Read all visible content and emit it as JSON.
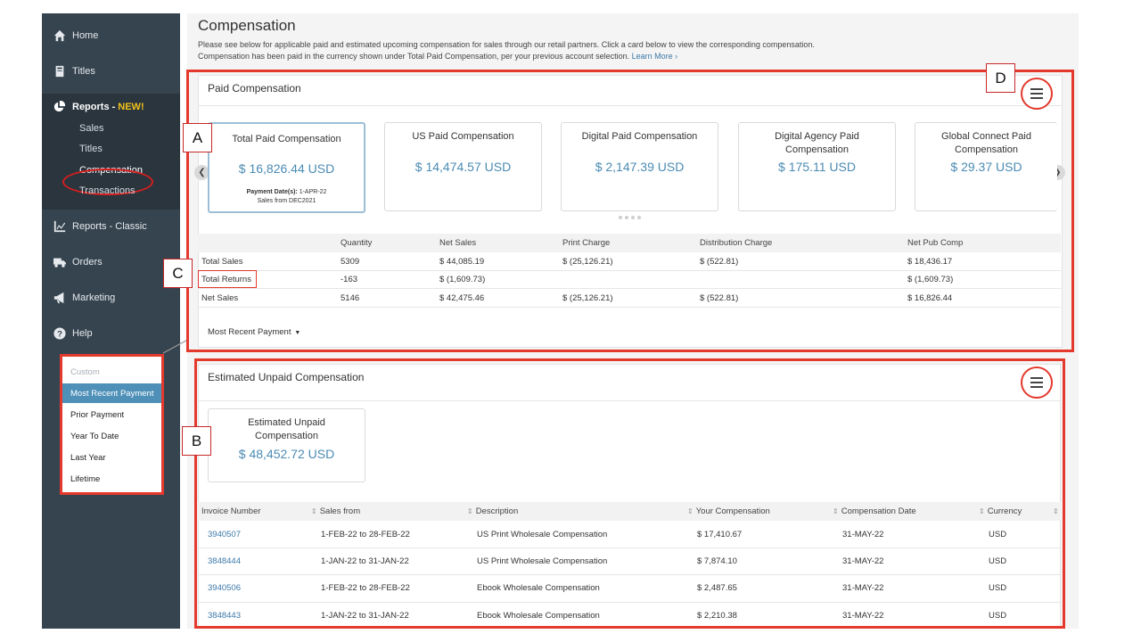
{
  "sidebar": {
    "home": "Home",
    "titles": "Titles",
    "reports": "Reports -",
    "reports_badge": "NEW!",
    "reports_sub": [
      "Sales",
      "Titles",
      "Compensation",
      "Transactions"
    ],
    "reports_classic": "Reports - Classic",
    "orders": "Orders",
    "marketing": "Marketing",
    "help": "Help"
  },
  "dropdown": {
    "options": [
      "Custom",
      "Most Recent Payment",
      "Prior Payment",
      "Year To Date",
      "Last Year",
      "Lifetime"
    ],
    "selected": "Most Recent Payment"
  },
  "header": {
    "title": "Compensation",
    "intro_line1": "Please see below for applicable paid and estimated upcoming compensation for sales through our  retail partners. Click a card below to view the corresponding compensation.",
    "intro_line2": "Compensation has been paid in the currency shown under Total Paid Compensation, per your previous account selection.",
    "learn_more": "Learn More ›"
  },
  "paid": {
    "title": "Paid Compensation",
    "cards": [
      {
        "title": "Total Paid Compensation",
        "amount": "$ 16,826.44 USD",
        "note1_label": "Payment Date(s):",
        "note1_value": "1-APR-22",
        "note2": "Sales from DEC2021"
      },
      {
        "title": "US Paid Compensation",
        "amount": "$ 14,474.57 USD"
      },
      {
        "title": "Digital Paid Compensation",
        "amount": "$ 2,147.39 USD"
      },
      {
        "title": "Digital Agency Paid Compensation",
        "amount": "$ 175.11 USD"
      },
      {
        "title": "Global Connect Paid Compensation",
        "amount": "$ 29.37 USD"
      }
    ],
    "columns": [
      "Quantity",
      "Net Sales",
      "Print Charge",
      "Distribution Charge",
      "Net Pub Comp"
    ],
    "rows": [
      {
        "label": "Total Sales",
        "quantity": "5309",
        "net_sales": "$ 44,085.19",
        "print_charge": "$ (25,126.21)",
        "distribution": "$ (522.81)",
        "net_pub": "$ 18,436.17"
      },
      {
        "label": "Total Returns",
        "quantity": "-163",
        "net_sales": "$ (1,609.73)",
        "print_charge": "",
        "distribution": "",
        "net_pub": "$ (1,609.73)"
      },
      {
        "label": "Net Sales",
        "quantity": "5146",
        "net_sales": "$ 42,475.46",
        "print_charge": "$ (25,126.21)",
        "distribution": "$ (522.81)",
        "net_pub": "$ 16,826.44"
      }
    ],
    "period_button": "Most Recent Payment"
  },
  "unpaid": {
    "title": "Estimated Unpaid Compensation",
    "card": {
      "title": "Estimated Unpaid Compensation",
      "amount": "$ 48,452.72 USD"
    },
    "columns": [
      "Invoice Number",
      "Sales from",
      "Description",
      "Your Compensation",
      "Compensation Date",
      "Currency"
    ],
    "rows": [
      {
        "invoice": "3940507",
        "sales_from": "1-FEB-22 to 28-FEB-22",
        "description": "US Print Wholesale Compensation",
        "comp": "$ 17,410.67",
        "date": "31-MAY-22",
        "currency": "USD"
      },
      {
        "invoice": "3848444",
        "sales_from": "1-JAN-22 to 31-JAN-22",
        "description": "US Print Wholesale Compensation",
        "comp": "$ 7,874.10",
        "date": "31-MAY-22",
        "currency": "USD"
      },
      {
        "invoice": "3940506",
        "sales_from": "1-FEB-22 to 28-FEB-22",
        "description": "Ebook Wholesale Compensation",
        "comp": "$ 2,487.65",
        "date": "31-MAY-22",
        "currency": "USD"
      },
      {
        "invoice": "3848443",
        "sales_from": "1-JAN-22 to 31-JAN-22",
        "description": "Ebook Wholesale Compensation",
        "comp": "$ 2,210.38",
        "date": "31-MAY-22",
        "currency": "USD"
      }
    ]
  },
  "annotations": {
    "a": "A",
    "b": "B",
    "c": "C",
    "d": "D"
  },
  "colors": {
    "sidebar": "#36444f",
    "accent": "#4b8bb3",
    "highlight": "#e4392d",
    "link": "#3b78a8"
  }
}
